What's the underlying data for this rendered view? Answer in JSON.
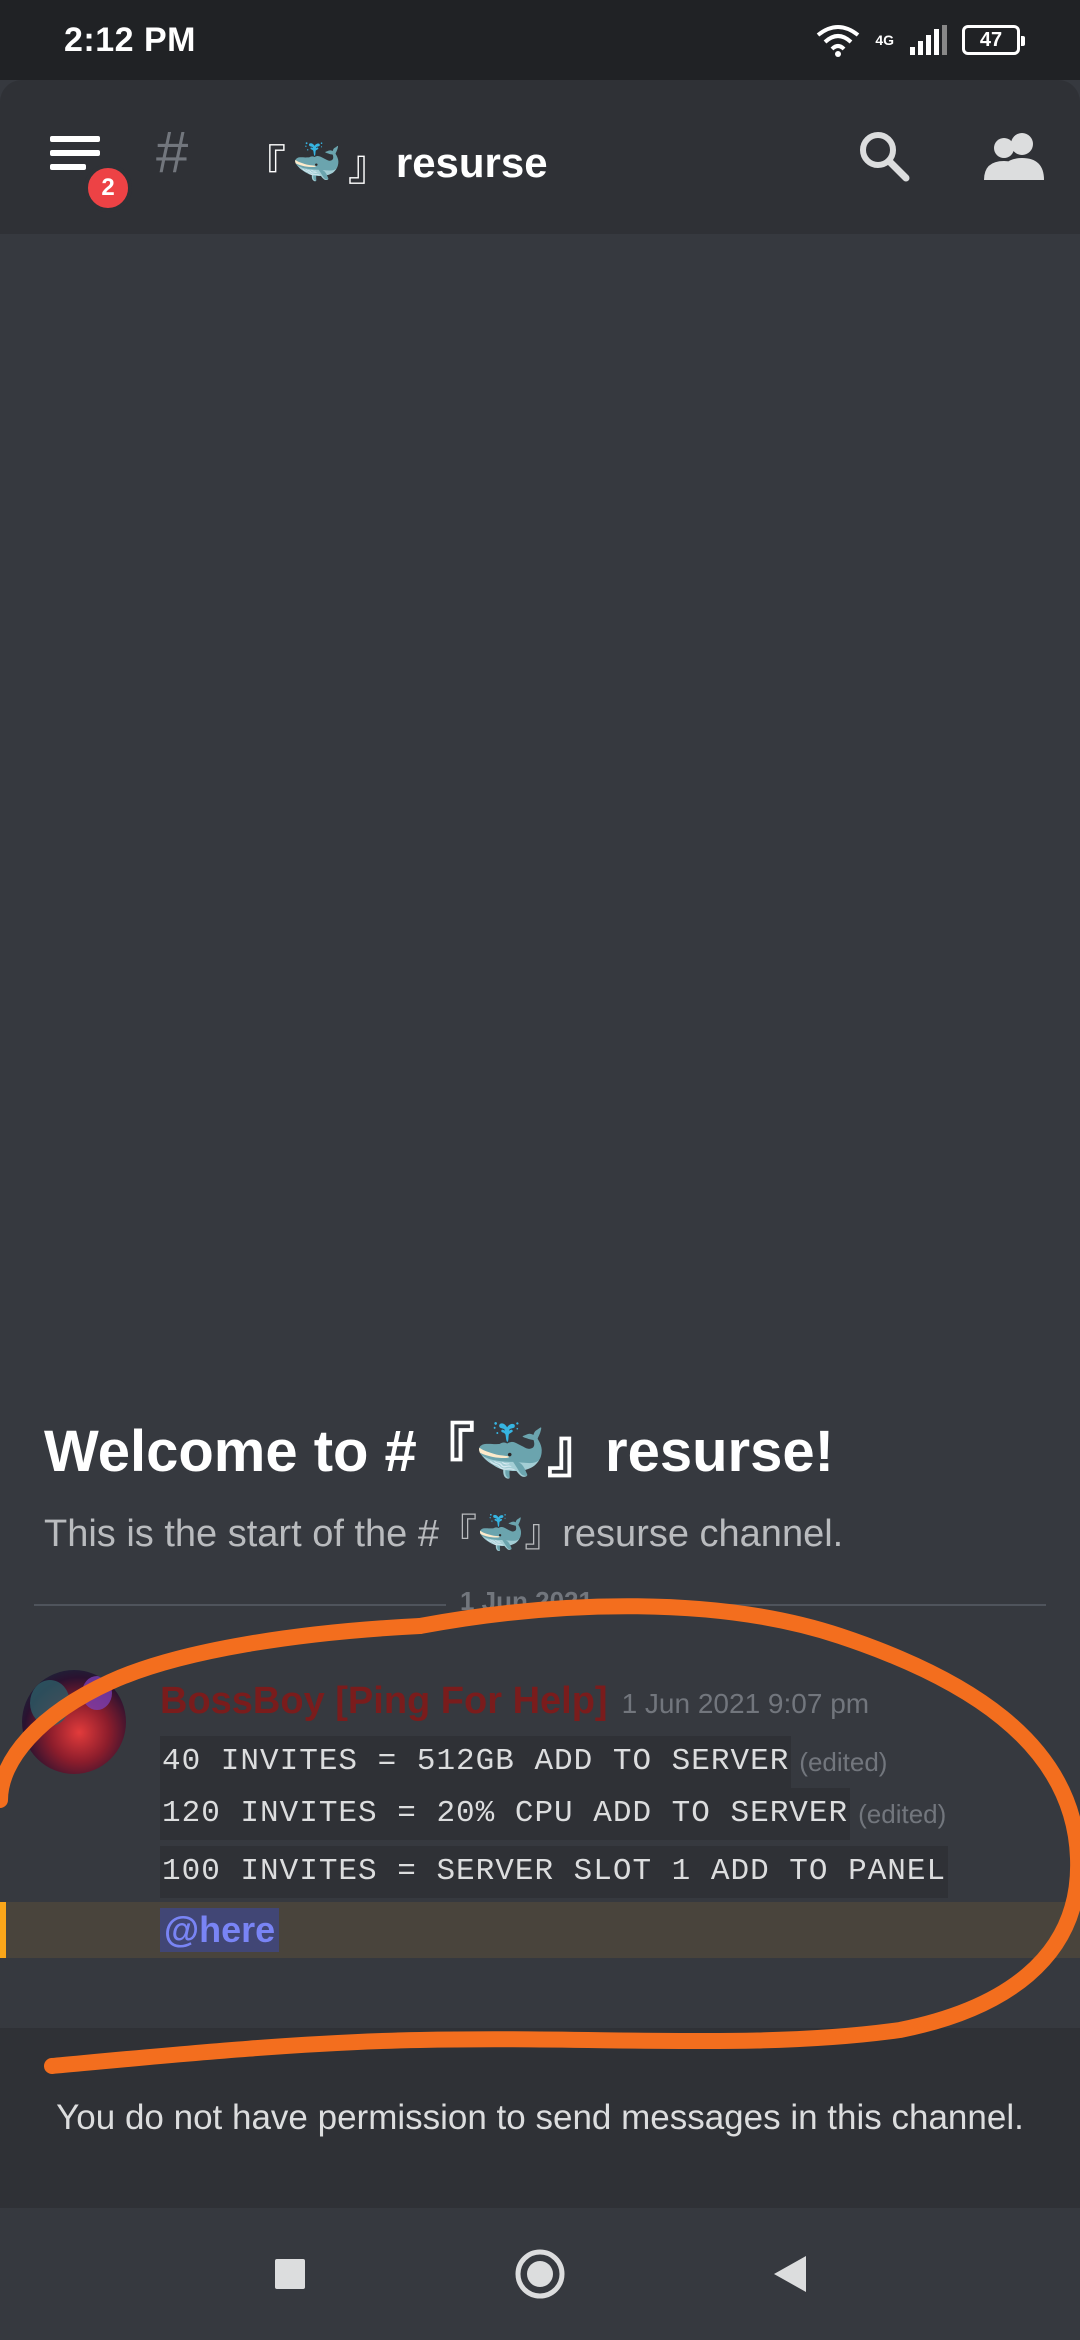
{
  "status_bar": {
    "time": "2:12 PM",
    "network": "4G",
    "battery": "47"
  },
  "header": {
    "notification_count": "2",
    "channel_name": "resurse",
    "bracket_open": "『",
    "bracket_close": "』",
    "channel_emoji": "🐳"
  },
  "welcome": {
    "title": "Welcome to #『🐳』resurse!",
    "subtitle": "This is the start of the #『🐳』resurse channel."
  },
  "date_divider": "1 Jun 2021",
  "message": {
    "username": "BossBoy [Ping For Help]",
    "timestamp": "1 Jun 2021 9:07 pm",
    "lines": [
      {
        "text": "40 INVITES = 512GB ADD TO SERVER",
        "edited": "(edited)"
      },
      {
        "text": "120 INVITES = 20% CPU ADD TO SERVER",
        "edited": "(edited)"
      },
      {
        "text": "100 INVITES = SERVER SLOT 1 ADD TO PANEL",
        "edited": ""
      }
    ],
    "mention": "@here"
  },
  "composer": {
    "permission_notice": "You do not have permission to send messages in this channel."
  },
  "icons": {
    "menu": "hamburger-menu-icon",
    "channel": "hash-icon",
    "search": "search-icon",
    "members": "members-icon",
    "nav_recents": "square-icon",
    "nav_home": "circle-icon",
    "nav_back": "triangle-back-icon"
  },
  "colors": {
    "background": "#36393f",
    "header": "#2f3136",
    "badge": "#ed4245",
    "mention_highlight": "#49443c",
    "mention_bar": "#faa61a",
    "mention_text": "#7984f5",
    "username": "#7a1c1c",
    "scribble": "#f36e1e"
  }
}
